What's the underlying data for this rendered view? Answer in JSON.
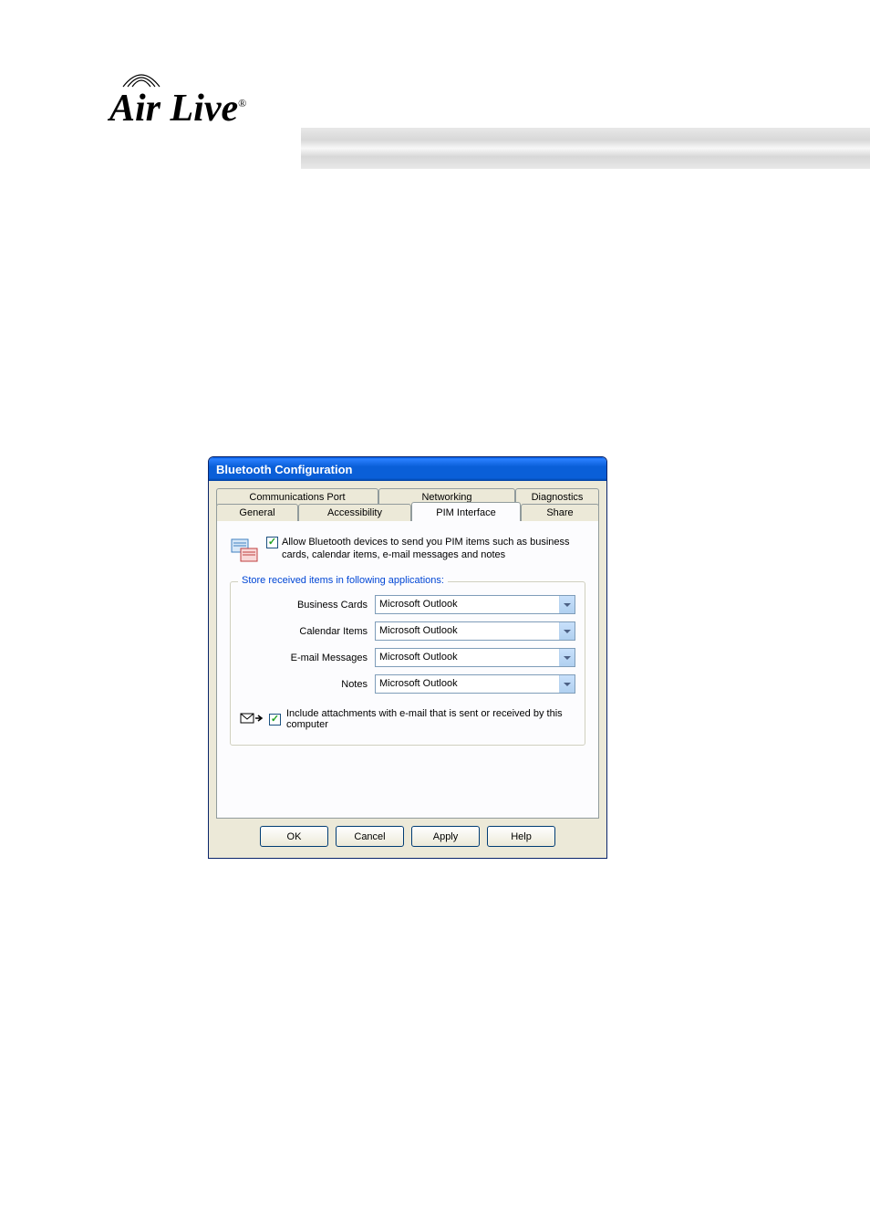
{
  "logo": {
    "text": "Air Live"
  },
  "dialog": {
    "title": "Bluetooth Configuration",
    "tabs_row1": [
      {
        "label": "Communications Port"
      },
      {
        "label": "Networking"
      },
      {
        "label": "Diagnostics"
      }
    ],
    "tabs_row2": [
      {
        "label": "General"
      },
      {
        "label": "Accessibility"
      },
      {
        "label": "PIM Interface",
        "active": true
      },
      {
        "label": "Share"
      }
    ],
    "allow_text": "Allow Bluetooth devices to send you PIM items such as business cards, calendar items, e-mail messages and notes",
    "groupbox_title": "Store received items in following applications:",
    "fields": [
      {
        "label": "Business Cards",
        "value": "Microsoft Outlook"
      },
      {
        "label": "Calendar Items",
        "value": "Microsoft Outlook"
      },
      {
        "label": "E-mail Messages",
        "value": "Microsoft Outlook"
      },
      {
        "label": "Notes",
        "value": "Microsoft Outlook"
      }
    ],
    "attach_text": "Include attachments with e-mail that is sent or received by this computer",
    "buttons": {
      "ok": "OK",
      "cancel": "Cancel",
      "apply": "Apply",
      "help": "Help"
    }
  }
}
